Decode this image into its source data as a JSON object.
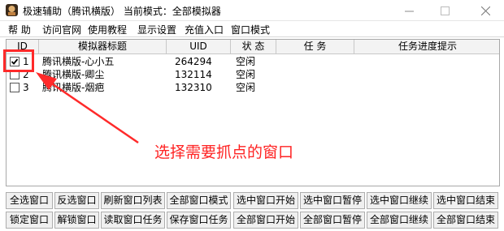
{
  "window": {
    "title": "极速辅助（腾讯横版）  当前模式：全部模拟器"
  },
  "menu": [
    "帮 助",
    "访问官网",
    "使用教程",
    "显示设置",
    "充值入口",
    "窗口模式"
  ],
  "table": {
    "columns": [
      "ID",
      "模拟器标题",
      "UID",
      "状 态",
      "任 务",
      "任务进度提示"
    ],
    "rows": [
      {
        "checked": true,
        "id": "1",
        "title": "腾讯横版-心小五",
        "uid": "264294",
        "status": "空闲",
        "task": "",
        "progress": ""
      },
      {
        "checked": false,
        "id": "2",
        "title": "腾讯横版-卿尘",
        "uid": "132114",
        "status": "空闲",
        "task": "",
        "progress": ""
      },
      {
        "checked": false,
        "id": "3",
        "title": "腾讯横版-烟疤",
        "uid": "132310",
        "status": "空闲",
        "task": "",
        "progress": ""
      }
    ]
  },
  "annotation": {
    "text": "选择需要抓点的窗口",
    "color": "#ff2323"
  },
  "buttons": {
    "row1": [
      "全选窗口",
      "反选窗口",
      "刷新窗口列表",
      "全部窗口模式",
      "选中窗口开始",
      "选中窗口暂停",
      "选中窗口继续",
      "选中窗口结束"
    ],
    "row2": [
      "锁定窗口",
      "解锁窗口",
      "读取窗口任务",
      "保存窗口任务",
      "全部窗口开始",
      "全部窗口暂停",
      "全部窗口继续",
      "全部窗口结束"
    ]
  }
}
